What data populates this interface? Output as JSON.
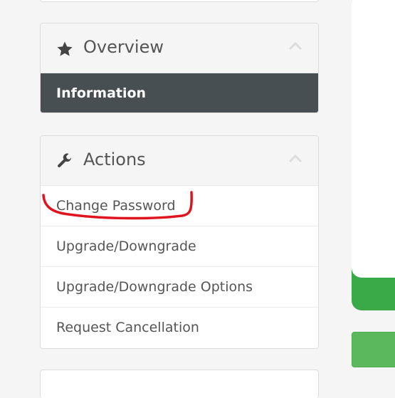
{
  "overview": {
    "title": "Overview",
    "icon": "star-icon",
    "active_item": "Information"
  },
  "actions": {
    "title": "Actions",
    "icon": "wrench-icon",
    "items": [
      {
        "label": "Change Password"
      },
      {
        "label": "Upgrade/Downgrade"
      },
      {
        "label": "Upgrade/Downgrade Options"
      },
      {
        "label": "Request Cancellation"
      }
    ]
  },
  "colors": {
    "active_bg": "#474f53",
    "text": "#555555",
    "accent_green": "#3aaa49",
    "annotation_red": "#e0141e"
  }
}
